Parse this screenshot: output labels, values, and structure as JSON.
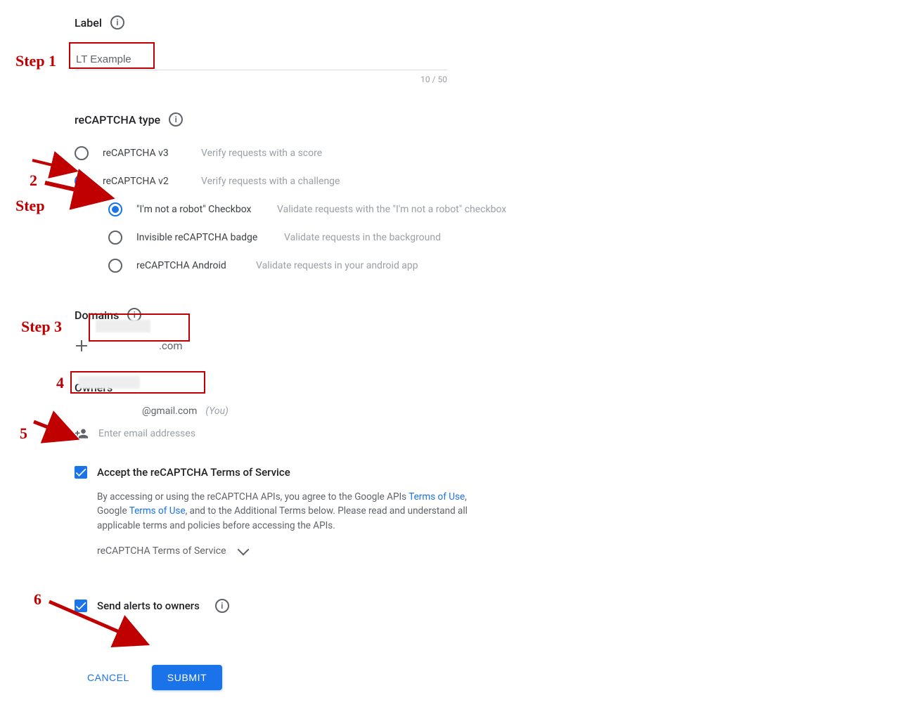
{
  "label_section": {
    "title": "Label",
    "value": "LT Example",
    "counter": "10 / 50"
  },
  "recaptcha_type": {
    "title": "reCAPTCHA type",
    "options": [
      {
        "id": "v3",
        "label": "reCAPTCHA v3",
        "desc": "Verify requests with a score",
        "selected": false
      },
      {
        "id": "v2",
        "label": "reCAPTCHA v2",
        "desc": "Verify requests with a challenge",
        "selected": true
      }
    ],
    "v2_sub": [
      {
        "id": "checkbox",
        "label": "\"I'm not a robot\" Checkbox",
        "desc": "Validate requests with the \"I'm not a robot\" checkbox",
        "selected": true
      },
      {
        "id": "invisible",
        "label": "Invisible reCAPTCHA badge",
        "desc": "Validate requests in the background",
        "selected": false
      },
      {
        "id": "android",
        "label": "reCAPTCHA Android",
        "desc": "Validate requests in your android app",
        "selected": false
      }
    ]
  },
  "domains": {
    "title": "Domains",
    "entry_visible_suffix": ".com"
  },
  "owners": {
    "title": "Owners",
    "first_suffix": "@gmail.com",
    "you_label": "(You)",
    "add_placeholder": "Enter email addresses"
  },
  "tos": {
    "label": "Accept the reCAPTCHA Terms of Service",
    "body_1": "By accessing or using the reCAPTCHA APIs, you agree to the Google APIs ",
    "link_1": "Terms of Use",
    "body_2": ", Google ",
    "link_2": "Terms of Use",
    "body_3": ", and to the Additional Terms below. Please read and understand all applicable terms and policies before accessing the APIs.",
    "expand_label": "reCAPTCHA Terms of Service"
  },
  "alerts": {
    "label": "Send alerts to owners"
  },
  "buttons": {
    "cancel": "CANCEL",
    "submit": "SUBMIT"
  },
  "annotations": {
    "step1": "Step 1",
    "step2_a": "2",
    "step2_b": "Step",
    "step3": "Step 3",
    "step4": "4",
    "step5": "5",
    "step6": "6"
  }
}
